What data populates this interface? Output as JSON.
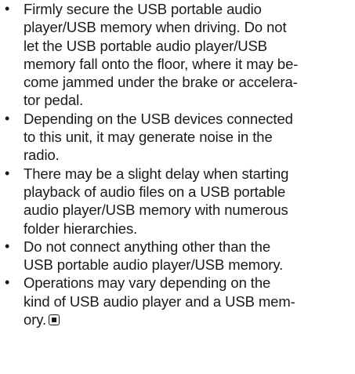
{
  "bullet_symbol": "•",
  "items": [
    {
      "lines": [
        "Firmly secure the USB portable audio",
        "player/USB memory when driving. Do not",
        "let the USB portable audio player/USB",
        "memory fall onto the floor, where it may be-",
        "come jammed under the brake or accelera-",
        "tor pedal."
      ]
    },
    {
      "lines": [
        "Depending on the USB devices connected",
        "to this unit, it may generate noise in the",
        "radio."
      ]
    },
    {
      "lines": [
        "There may be a slight delay when starting",
        "playback of audio files on a USB portable",
        "audio player/USB memory with numerous",
        "folder hierarchies."
      ]
    },
    {
      "lines": [
        "Do not connect anything other than the",
        "USB portable audio player/USB memory."
      ]
    },
    {
      "lines": [
        "Operations may vary depending on the",
        "kind of USB audio player and a USB mem-",
        "ory."
      ],
      "end_icon": "section-end-icon"
    }
  ]
}
